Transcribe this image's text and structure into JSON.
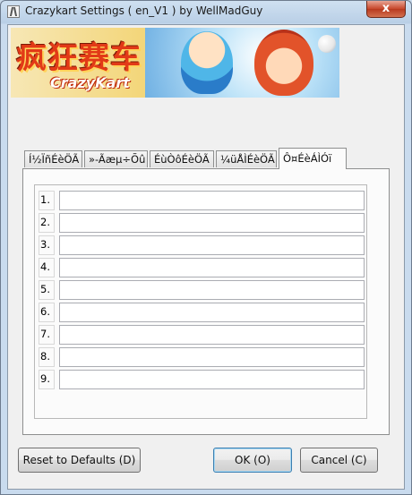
{
  "window": {
    "title": "Crazykart Settings ( en_V1 ) by WellMadGuy",
    "close_label": "x",
    "icon": "app-icon"
  },
  "banner": {
    "logo_cn": "疯狂赛车",
    "logo_en": "CrazyKart"
  },
  "tabs": [
    {
      "label": "Í½ÏñÉèÖÃ",
      "active": false
    },
    {
      "label": "»-Ãæµ÷Õû",
      "active": false
    },
    {
      "label": "ÉùÒôÉèÖÃ",
      "active": false
    },
    {
      "label": "¼üÅÌÉèÖÃ",
      "active": false
    },
    {
      "label": "Ô¤ÉèÁÌÓï",
      "active": true
    }
  ],
  "rows": [
    {
      "num": "1.",
      "value": ""
    },
    {
      "num": "2.",
      "value": ""
    },
    {
      "num": "3.",
      "value": ""
    },
    {
      "num": "4.",
      "value": ""
    },
    {
      "num": "5.",
      "value": ""
    },
    {
      "num": "6.",
      "value": ""
    },
    {
      "num": "7.",
      "value": ""
    },
    {
      "num": "8.",
      "value": ""
    },
    {
      "num": "9.",
      "value": ""
    }
  ],
  "buttons": {
    "reset": "Reset to Defaults (D)",
    "ok": "OK (O)",
    "cancel": "Cancel (C)"
  }
}
